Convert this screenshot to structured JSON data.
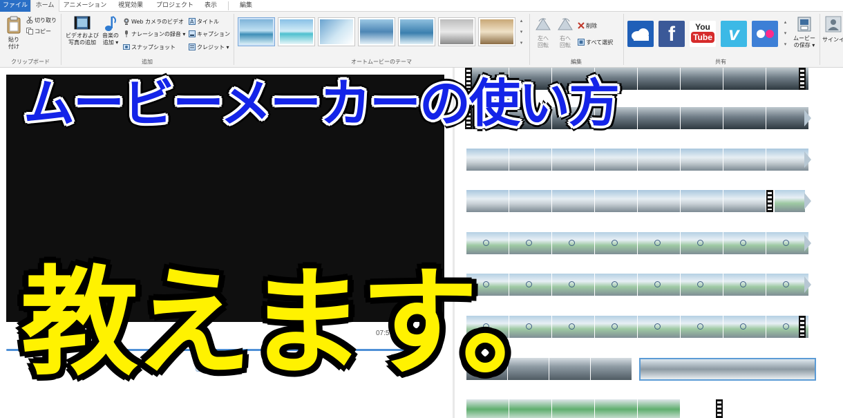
{
  "tabs": [
    {
      "label": "ファイル",
      "state": "file"
    },
    {
      "label": "ホーム",
      "state": "active"
    },
    {
      "label": "アニメーション",
      "state": ""
    },
    {
      "label": "視覚効果",
      "state": ""
    },
    {
      "label": "プロジェクト",
      "state": ""
    },
    {
      "label": "表示",
      "state": ""
    },
    {
      "label": "編集",
      "state": ""
    }
  ],
  "ribbon": {
    "clipboard": {
      "paste_label_1": "貼り",
      "paste_label_2": "付け",
      "cut": "切り取り",
      "copy": "コピー",
      "group": "クリップボード"
    },
    "add": {
      "video_photo_1": "ビデオおよび",
      "video_photo_2": "写真の追加",
      "music_1": "音楽の",
      "music_2": "追加 ▾",
      "webcam": "Web カメラのビデオ",
      "narration": "ナレーションの録音 ▾",
      "snapshot": "スナップショット",
      "title": "タイトル",
      "caption": "キャプション",
      "credit": "クレジット ▾",
      "group": "追加"
    },
    "themes": {
      "group": "オートムービーのテーマ"
    },
    "edit": {
      "rotate_left_1": "左へ",
      "rotate_left_2": "回転",
      "rotate_right_1": "右へ",
      "rotate_right_2": "回転",
      "delete": "削除",
      "select_all": "すべて選択",
      "group": "編集"
    },
    "share": {
      "group": "共有",
      "youtube_1": "You",
      "youtube_2": "Tube",
      "save_movie_1": "ムービー",
      "save_movie_2": "の保存 ▾",
      "signin": "サインイ"
    }
  },
  "preview": {
    "time": "07:57.87/08",
    "seek_progress": 0.995
  },
  "overlay": {
    "title_top": "ムービーメーカーの使い方",
    "title_bottom": "教えます。"
  },
  "colors": {
    "file_tab": "#2a6fc6",
    "overlay_blue": "#1424e8",
    "overlay_yellow": "#fff200",
    "seek_bar": "#4e8fd6"
  }
}
